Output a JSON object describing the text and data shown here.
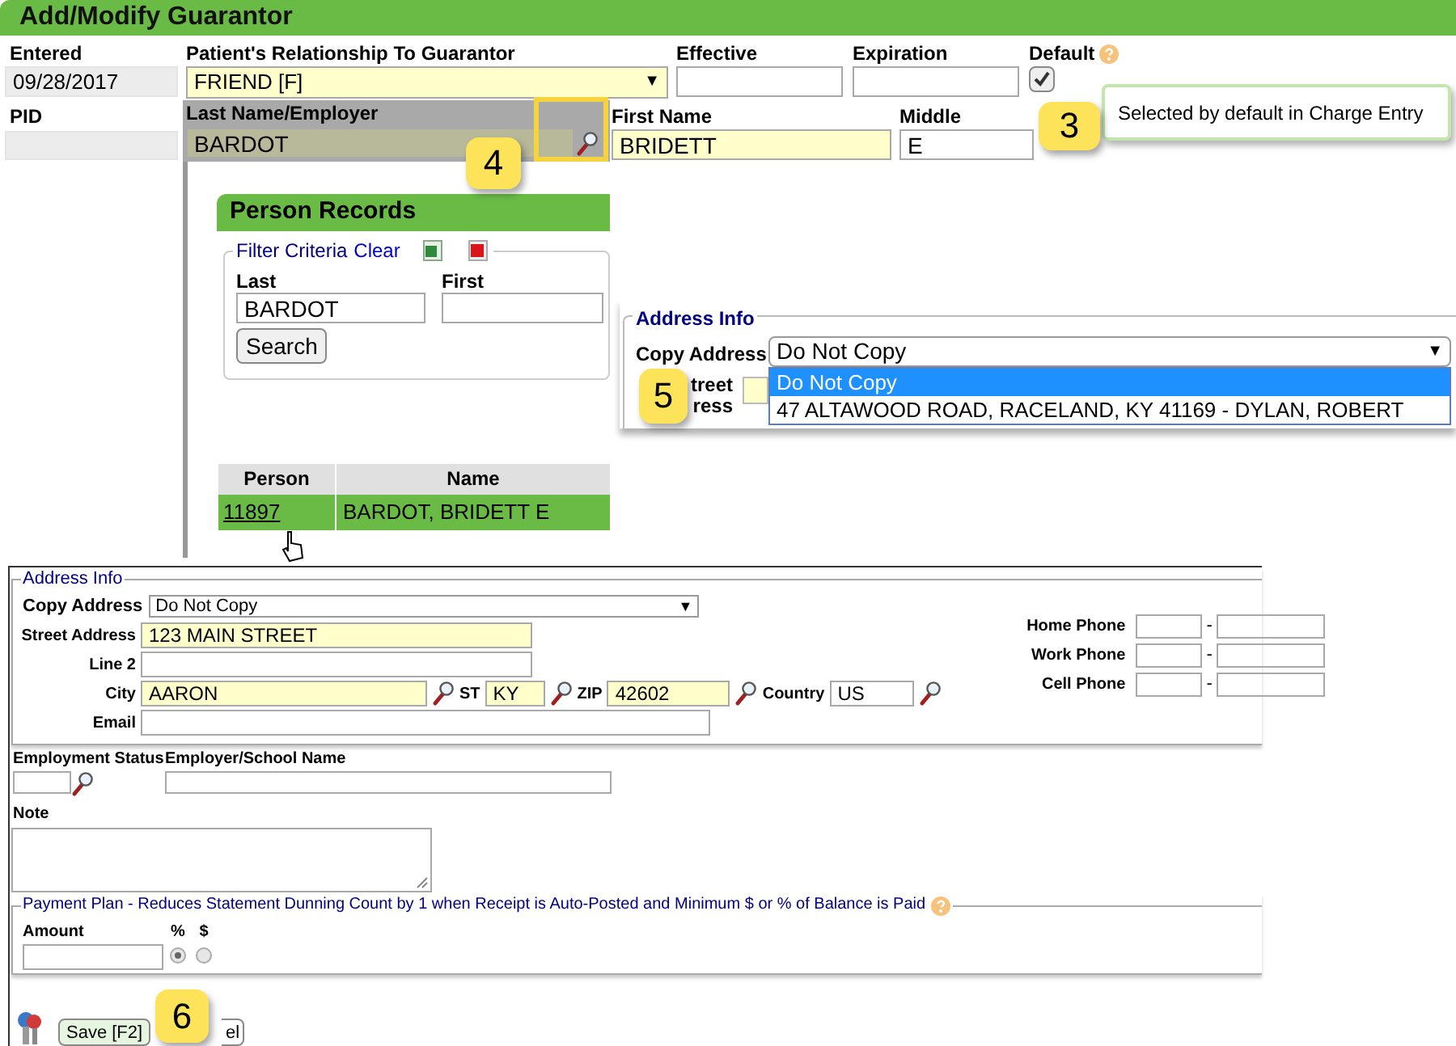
{
  "header": {
    "title": "Add/Modify Guarantor"
  },
  "entered": {
    "label": "Entered",
    "value": "09/28/2017"
  },
  "pid": {
    "label": "PID"
  },
  "relationship": {
    "label": "Patient's Relationship To Guarantor",
    "value": "FRIEND [F]",
    "arrow": "▼"
  },
  "effective": {
    "label": "Effective"
  },
  "expiration": {
    "label": "Expiration"
  },
  "default": {
    "label": "Default",
    "checked": true
  },
  "tooltip": {
    "text": "Selected by default in Charge Entry"
  },
  "last_name": {
    "label": "Last Name/Employer",
    "value": "BARDOT"
  },
  "first_name": {
    "label": "First Name",
    "value": "BRIDETT"
  },
  "middle": {
    "label": "Middle",
    "value": "E"
  },
  "callouts": {
    "three": "3",
    "four": "4",
    "five": "5",
    "six": "6"
  },
  "person_records": {
    "title": "Person Records",
    "filter_label": "Filter Criteria",
    "clear_link": "Clear",
    "last_label": "Last",
    "last_value": "BARDOT",
    "first_label": "First",
    "search_button": "Search",
    "columns": [
      "Person",
      "Name"
    ],
    "rows": [
      {
        "person": "11897",
        "name": "BARDOT, BRIDETT E",
        "selected": true
      }
    ]
  },
  "address_popup": {
    "legend": "Address Info",
    "copy_label": "Copy Address",
    "value": "Do Not Copy",
    "arrow": "▼",
    "street_fragment": [
      "treet",
      "ress"
    ],
    "options": [
      {
        "label": "Do Not Copy",
        "selected": true
      },
      {
        "label": "47 ALTAWOOD ROAD, RACELAND, KY 41169 - DYLAN, ROBERT",
        "selected": false
      }
    ]
  },
  "address": {
    "legend": "Address Info",
    "copy_label": "Copy Address",
    "copy_value": "Do Not Copy",
    "arrow": "▼",
    "street_label": "Street Address",
    "street_value": "123 MAIN STREET",
    "line2_label": "Line 2",
    "city_label": "City",
    "city_value": "AARON",
    "st_label": "ST",
    "st_value": "KY",
    "zip_label": "ZIP",
    "zip_value": "42602",
    "country_label": "Country",
    "country_value": "US",
    "email_label": "Email",
    "phones": [
      {
        "label": "Home Phone",
        "separator": "-"
      },
      {
        "label": "Work Phone",
        "separator": "-"
      },
      {
        "label": "Cell Phone",
        "separator": "-"
      }
    ]
  },
  "employment": {
    "status_label": "Employment Status",
    "employer_label": "Employer/School Name",
    "note_label": "Note"
  },
  "payment_plan": {
    "legend": "Payment Plan - Reduces Statement Dunning Count by 1 when Receipt is Auto-Posted and Minimum $ or % of Balance is Paid",
    "amount_label": "Amount",
    "options": [
      {
        "label": "%",
        "selected": true
      },
      {
        "label": "$",
        "selected": false
      }
    ]
  },
  "buttons": {
    "save": "Save [F2]",
    "cancel_fragment": "el"
  }
}
